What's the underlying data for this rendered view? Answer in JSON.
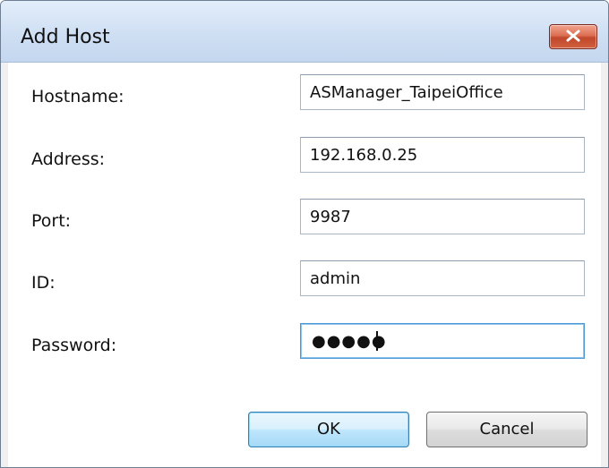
{
  "window": {
    "title": "Add Host",
    "close_icon": "close-icon"
  },
  "fields": {
    "hostname": {
      "label": "Hostname:",
      "value": "ASManager_TaipeiOffice"
    },
    "address": {
      "label": "Address:",
      "value": "192.168.0.25"
    },
    "port": {
      "label": "Port:",
      "value": "9987"
    },
    "id": {
      "label": "ID:",
      "value": "admin"
    },
    "password": {
      "label": "Password:",
      "masked_value": "●●●●●"
    }
  },
  "buttons": {
    "ok": "OK",
    "cancel": "Cancel"
  },
  "colors": {
    "titlebar": "#cfdff3",
    "close_button": "#c0472b",
    "focus_border": "#4d9ad6"
  }
}
